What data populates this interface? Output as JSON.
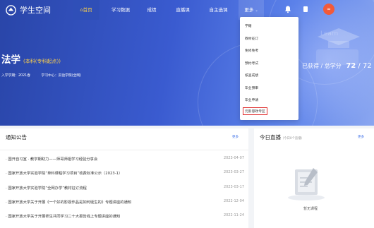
{
  "brand": {
    "name": "学生空间"
  },
  "nav": {
    "items": [
      {
        "label": "首页",
        "active": true
      },
      {
        "label": "学习数据"
      },
      {
        "label": "成绩"
      },
      {
        "label": "直播课"
      },
      {
        "label": "自主选课"
      },
      {
        "label": "更多"
      }
    ],
    "avatar_text": "∞"
  },
  "student": {
    "major": "法学",
    "level": "(本科(专科起点))",
    "enroll": "入学学期：2021春",
    "center": "学习中心：实验学院(全网)",
    "credits_label": "已获得 / 总学分",
    "credits_got": "72",
    "credits_sep": " / ",
    "credits_total": "72"
  },
  "more_menu": {
    "items": [
      "学籍",
      "教材征订",
      "免修免考",
      "预约考试",
      "核查成绩",
      "毕业预审",
      "毕业申请",
      "元影思政专区"
    ],
    "highlighted_index": 7
  },
  "notices": {
    "title": "通知公告",
    "more": "更多",
    "items": [
      {
        "text": "国开自习室 · 教学期助力——师哥师姐学习经验分享会",
        "date": "2023-04-07"
      },
      {
        "text": "国家开放大学实验学院“单科课程学习项目”收费标准公示（2023-1）",
        "date": "2023-03-27"
      },
      {
        "text": "国家开放大学实验学院“全网办学”教材征订流程",
        "date": "2023-03-17"
      },
      {
        "text": "国家开放大学关于开展《一个好的影视作品是如何诞生的》专题讲座的通知",
        "date": "2022-12-04"
      },
      {
        "text": "国家开放大学关于开展师生共同学习二十大报告线上专题讲座的通知",
        "date": "2022-11-24"
      }
    ]
  },
  "live": {
    "title": "今日直播",
    "subtitle": "（今日0个直播）",
    "more": "更多",
    "empty": "暂无课程"
  },
  "colors": {
    "accent": "#3a5bd0",
    "highlight": "#ffd24a",
    "alert": "#e0302f"
  }
}
